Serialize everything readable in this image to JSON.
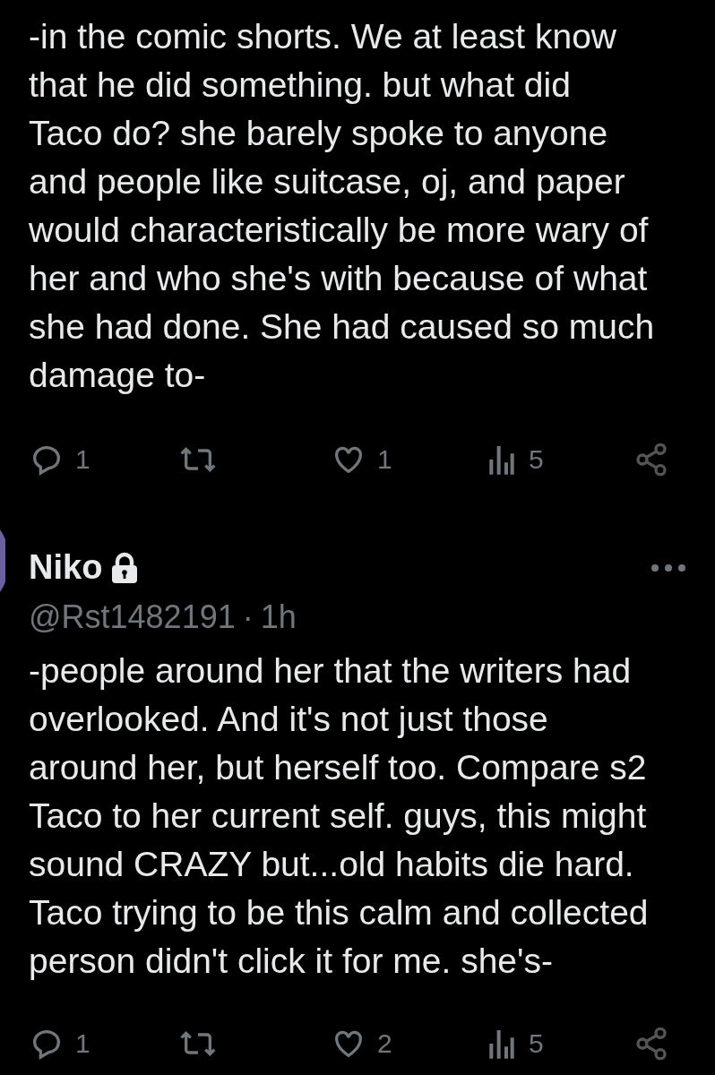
{
  "tweets": [
    {
      "text": "-in the comic shorts. We at least know\nthat he did something. but what did\nTaco do? she barely spoke to anyone\nand people like suitcase, oj, and paper\nwould characteristically be more wary of\nher and who she's with because of what\nshe had done. She had caused so much\ndamage to-",
      "replies": "1",
      "likes": "1",
      "views": "5"
    },
    {
      "name": "Niko",
      "protected": true,
      "handle": "@Rst1482191",
      "separator": "·",
      "time": "1h",
      "text": "-people around her that the writers had\noverlooked. And it's not just those\naround her, but herself too. Compare s2\nTaco to her current self. guys, this might\nsound CRAZY but...old habits die hard.\nTaco trying to be this calm and collected\nperson didn't click it for me. she's-",
      "replies": "1",
      "likes": "2",
      "views": "5"
    }
  ]
}
